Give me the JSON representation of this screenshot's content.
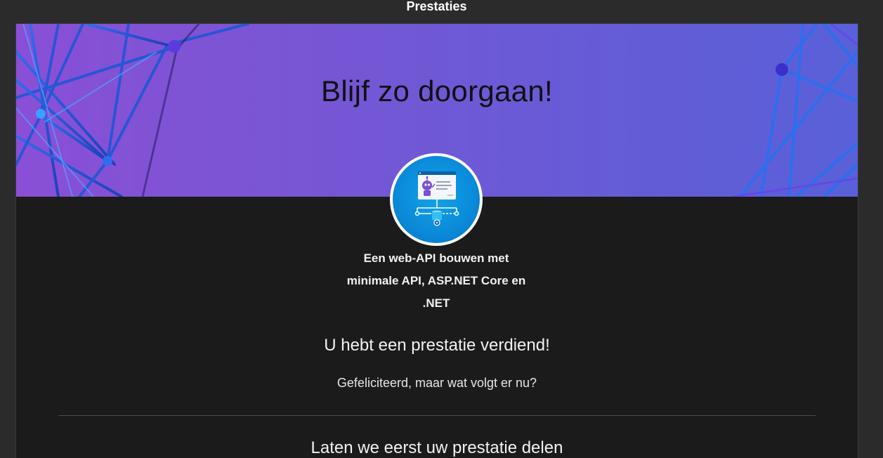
{
  "dialog": {
    "title": "Prestaties"
  },
  "banner": {
    "heading": "Blijf zo doorgaan!",
    "gradient_colors": [
      "#8a4fd6",
      "#5960d8"
    ]
  },
  "badge": {
    "icon": "web-api-module-badge-icon",
    "ring_color": "#ffffff",
    "fill_color": "#0a8ad8"
  },
  "module": {
    "name_lines": [
      "Een web-API bouwen met",
      "minimale API, ASP.NET Core en",
      ".NET"
    ]
  },
  "achievement": {
    "heading": "U hebt een prestatie verdiend!",
    "message": "Gefeliciteerd, maar wat volgt er nu?"
  },
  "share": {
    "heading": "Laten we eerst uw prestatie delen"
  }
}
